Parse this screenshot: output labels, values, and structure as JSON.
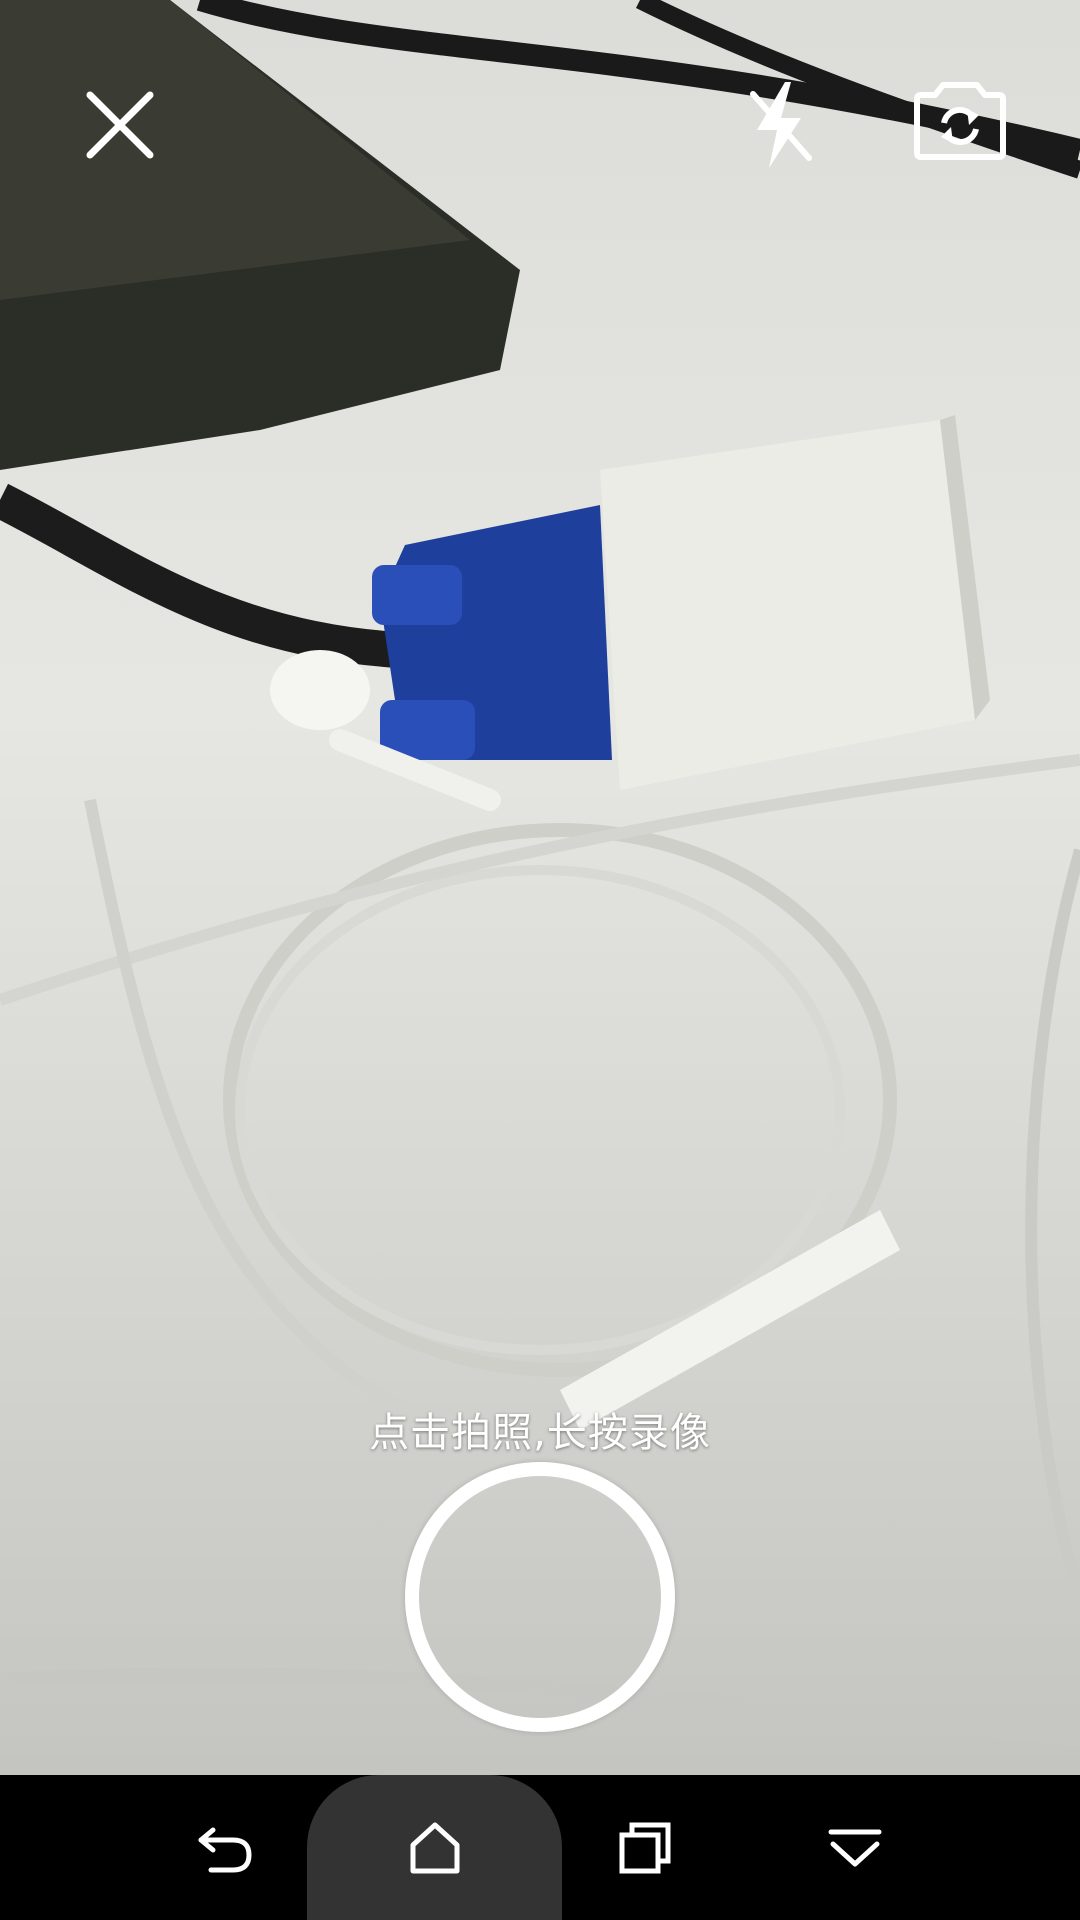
{
  "camera": {
    "hint_text": "点击拍照,长按录像",
    "icons": {
      "close": "close-icon",
      "flash": "flash-off-icon",
      "switch": "camera-switch-icon",
      "shutter": "shutter-button"
    }
  },
  "navbar": {
    "icons": {
      "back": "back-icon",
      "home": "home-icon",
      "recent": "recent-apps-icon",
      "menu": "chevron-down-icon"
    }
  },
  "colors": {
    "overlay_white": "#ffffff",
    "navbar_bg": "#000000",
    "home_pill": "#333333"
  }
}
